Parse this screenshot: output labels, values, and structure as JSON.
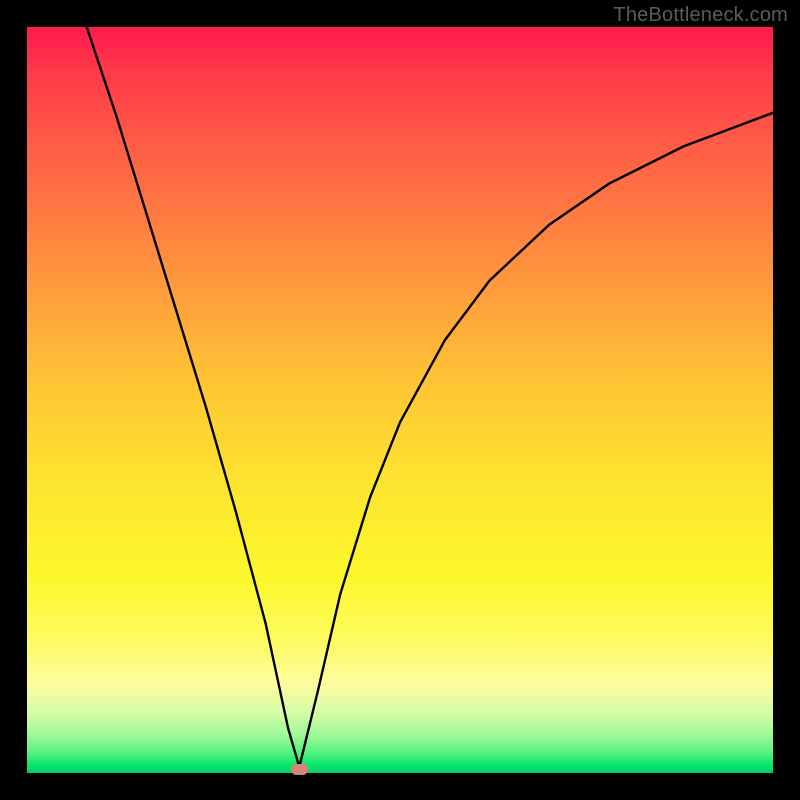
{
  "watermark": "TheBottleneck.com",
  "chart_data": {
    "type": "line",
    "title": "",
    "xlabel": "",
    "ylabel": "",
    "xlim": [
      0,
      100
    ],
    "ylim": [
      0,
      100
    ],
    "curve": {
      "type": "bottleneck-v",
      "min_x": 36.5,
      "left_branch": [
        {
          "x": 8.0,
          "y": 100.0
        },
        {
          "x": 12.0,
          "y": 88.0
        },
        {
          "x": 16.0,
          "y": 75.0
        },
        {
          "x": 20.0,
          "y": 62.0
        },
        {
          "x": 24.0,
          "y": 49.0
        },
        {
          "x": 28.0,
          "y": 35.0
        },
        {
          "x": 32.0,
          "y": 20.0
        },
        {
          "x": 35.0,
          "y": 6.0
        },
        {
          "x": 36.5,
          "y": 0.8
        }
      ],
      "right_branch": [
        {
          "x": 36.5,
          "y": 0.8
        },
        {
          "x": 39.0,
          "y": 11.0
        },
        {
          "x": 42.0,
          "y": 24.0
        },
        {
          "x": 46.0,
          "y": 37.0
        },
        {
          "x": 50.0,
          "y": 47.0
        },
        {
          "x": 56.0,
          "y": 58.0
        },
        {
          "x": 62.0,
          "y": 66.0
        },
        {
          "x": 70.0,
          "y": 73.5
        },
        {
          "x": 78.0,
          "y": 79.0
        },
        {
          "x": 88.0,
          "y": 84.0
        },
        {
          "x": 100.0,
          "y": 88.5
        }
      ]
    },
    "min_marker": {
      "x": 36.5,
      "y": 0.5,
      "color": "#d88378"
    },
    "gradient_stops": [
      {
        "pos": 0,
        "color": "#ff1a4d"
      },
      {
        "pos": 50,
        "color": "#ffc535"
      },
      {
        "pos": 80,
        "color": "#fdfb5f"
      },
      {
        "pos": 100,
        "color": "#05ce6d"
      }
    ]
  }
}
